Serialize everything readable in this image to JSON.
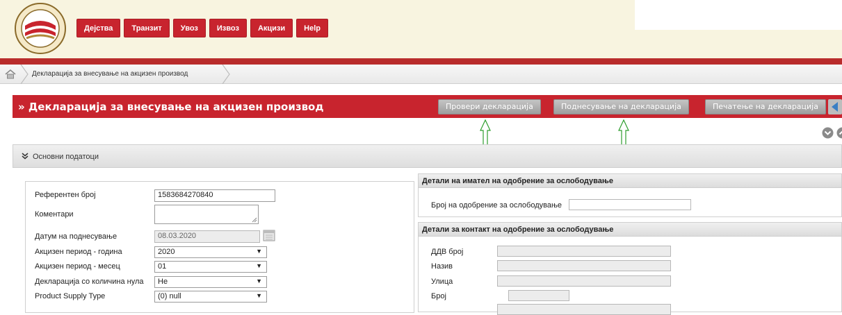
{
  "header": {
    "logo_icon": "customs-logo-seal",
    "nav": [
      "Дејства",
      "Транзит",
      "Увоз",
      "Извоз",
      "Акцизи",
      "Help"
    ]
  },
  "breadcrumb": {
    "home_icon": "home-icon",
    "text": "Декларација за внесување на акцизен производ"
  },
  "titlebar": {
    "title": "» Декларација за внесување на акцизен производ",
    "buttons": {
      "check": "Провери декларација",
      "submit": "Поднесување на декларација",
      "print": "Печатење на декларација"
    },
    "back_icon": "back-arrow-icon"
  },
  "section": {
    "title": "Основни податоци",
    "chevron_icon": "double-chevron-down-icon"
  },
  "form": {
    "reference_label": "Референтен број",
    "reference_value": "1583684270840",
    "comments_label": "Коментари",
    "submit_date_label": "Датум на поднесување",
    "submit_date_value": "08.03.2020",
    "year_label": "Акцизен период - година",
    "year_value": "2020",
    "month_label": "Акцизен период - месец",
    "month_value": "01",
    "zero_decl_label": "Декларација со количина нула",
    "zero_decl_value": "Не",
    "supply_type_label": "Product Supply Type",
    "supply_type_value": "(0) null"
  },
  "holder_panel": {
    "title": "Детали на имател на одобрение за ослободување",
    "approval_no_label": "Број на одобрение за ослободување"
  },
  "contact_panel": {
    "title": "Детали за контакт на одобрение за ослободување",
    "vat_label": "ДДВ број",
    "name_label": "Назив",
    "street_label": "Улица",
    "number_label": "Број"
  },
  "colors": {
    "brand_red": "#c8242e",
    "header_bg": "#f8f4e0",
    "button_gray": "#a8a8a8",
    "annotation_green": "#2e9e2e"
  }
}
